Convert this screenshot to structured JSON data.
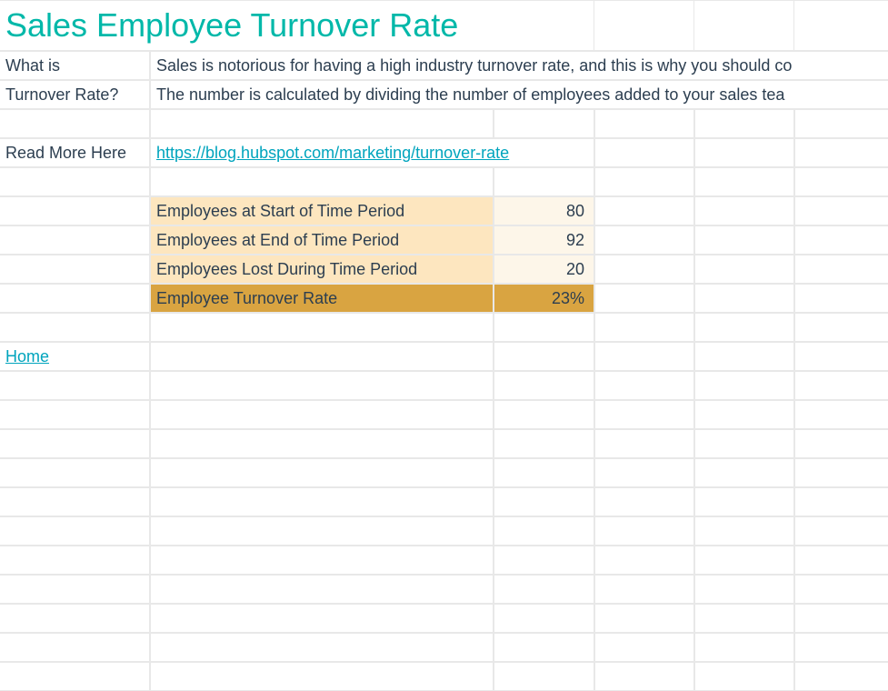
{
  "title": "Sales Employee Turnover Rate",
  "question_label_line1": "What is",
  "question_label_line2": "Turnover Rate?",
  "description_line1": "Sales is notorious for having a high industry turnover rate, and this is why you should co",
  "description_line2": "The number is calculated by dividing the number of employees added to your sales tea",
  "read_more_label": "Read More Here",
  "read_more_url": "https://blog.hubspot.com/marketing/turnover-rate",
  "table": {
    "rows": [
      {
        "label": "Employees at Start of Time Period",
        "value": "80"
      },
      {
        "label": "Employees at End of Time Period",
        "value": "92"
      },
      {
        "label": "Employees Lost During Time Period",
        "value": "20"
      }
    ],
    "result": {
      "label": "Employee Turnover Rate",
      "value": "23%"
    }
  },
  "home_link": "Home"
}
